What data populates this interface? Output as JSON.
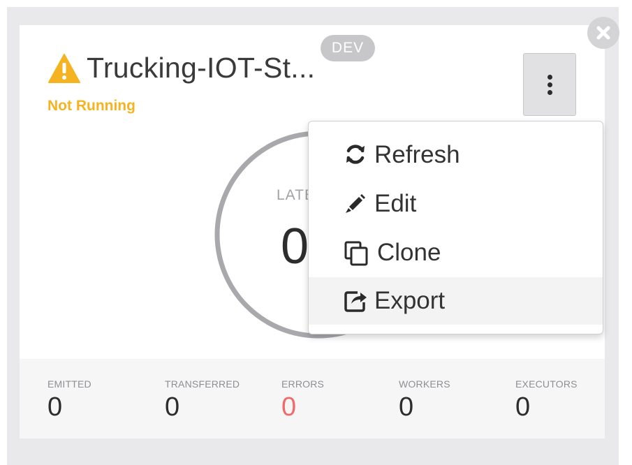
{
  "card": {
    "title": "Trucking-IOT-St...",
    "env_badge": "DEV",
    "status": "Not Running",
    "status_color": "#f5b321",
    "icons": {
      "status": "warning-triangle-icon",
      "close": "close-circle-icon",
      "menu": "vertical-ellipsis-icon"
    }
  },
  "gauge": {
    "label": "LATE",
    "value": "0"
  },
  "menu": {
    "items": [
      {
        "label": "Refresh",
        "icon": "refresh-icon"
      },
      {
        "label": "Edit",
        "icon": "pencil-icon"
      },
      {
        "label": "Clone",
        "icon": "clone-icon"
      },
      {
        "label": "Export",
        "icon": "export-icon"
      }
    ],
    "hovered": "Export"
  },
  "stats": [
    {
      "label": "EMITTED",
      "value": "0"
    },
    {
      "label": "TRANSFERRED",
      "value": "0"
    },
    {
      "label": "ERRORS",
      "value": "0",
      "color": "#f16a6a"
    },
    {
      "label": "WORKERS",
      "value": "0"
    },
    {
      "label": "EXECUTORS",
      "value": "0"
    }
  ]
}
